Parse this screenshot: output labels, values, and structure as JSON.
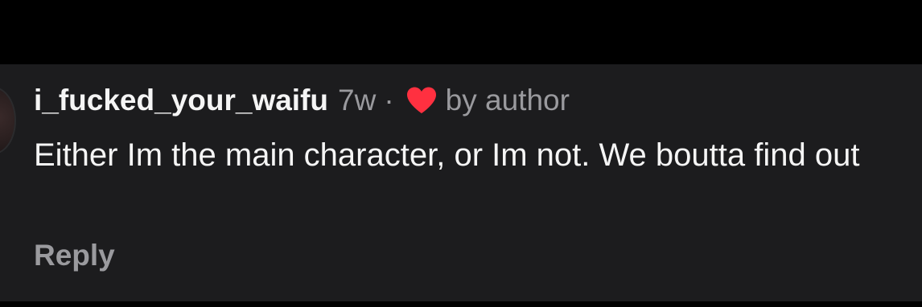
{
  "comment": {
    "username": "i_fucked_your_waifu",
    "timestamp": "7w",
    "separator": "·",
    "liked_by_label": "by author",
    "body": "Either Im the main character, or Im not. We boutta find out",
    "reply_label": "Reply"
  },
  "icons": {
    "heart": "heart-icon"
  },
  "colors": {
    "background": "#000000",
    "panel": "#1c1c1e",
    "primary_text": "#f5f5f5",
    "secondary_text": "#9a9a9e",
    "heart": "#ff3040"
  }
}
